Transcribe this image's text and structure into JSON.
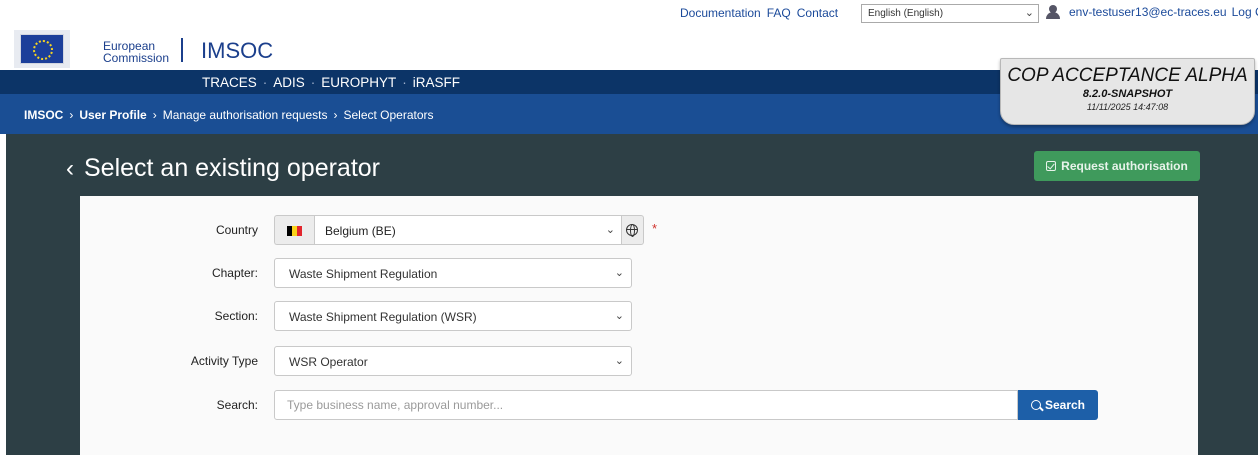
{
  "top_links": {
    "documentation": "Documentation",
    "faq": "FAQ",
    "contact": "Contact"
  },
  "language": {
    "selected": "English (English)"
  },
  "user": {
    "email": "env-testuser13@ec-traces.eu",
    "logout_label": "Log C"
  },
  "brand": {
    "org_line1": "European",
    "org_line2": "Commission",
    "app_name": "IMSOC"
  },
  "menu": {
    "items": [
      "TRACES",
      "ADIS",
      "EUROPHYT",
      "iRASFF"
    ],
    "separator": "·"
  },
  "breadcrumb": {
    "items": [
      "IMSOC",
      "User Profile",
      "Manage authorisation requests",
      "Select Operators"
    ],
    "separator": "›"
  },
  "version_box": {
    "environment": "COP ACCEPTANCE ALPHA",
    "version": "8.2.0-SNAPSHOT",
    "timestamp": "11/11/2025 14:47:08"
  },
  "page": {
    "title": "Select an existing operator",
    "request_button": "Request authorisation"
  },
  "form": {
    "country": {
      "label": "Country",
      "value": "Belgium (BE)",
      "flag_colors": [
        "#000000",
        "#f9d31a",
        "#e2262e"
      ],
      "required_mark": "*"
    },
    "chapter": {
      "label": "Chapter:",
      "value": "Waste Shipment Regulation"
    },
    "section": {
      "label": "Section:",
      "value": "Waste Shipment Regulation (WSR)"
    },
    "activity_type": {
      "label": "Activity Type",
      "value": "WSR Operator"
    },
    "search": {
      "label": "Search:",
      "placeholder": "Type business name, approval number...",
      "button_label": "Search"
    }
  },
  "colors": {
    "menu_bg": "#0c3467",
    "breadcrumb_bg": "#1a4e94",
    "main_bg": "#2d3f45",
    "request_button": "#3f9a5c",
    "search_button": "#1d5fa8"
  }
}
